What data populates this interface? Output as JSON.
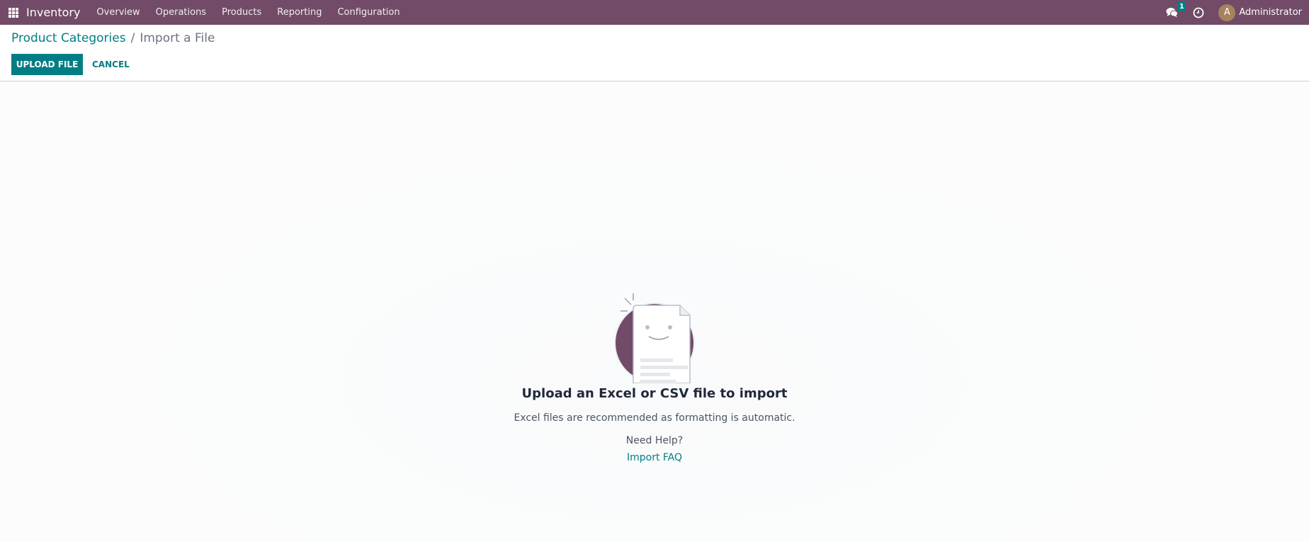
{
  "navbar": {
    "app_name": "Inventory",
    "menu": [
      "Overview",
      "Operations",
      "Products",
      "Reporting",
      "Configuration"
    ],
    "messages_badge": "1",
    "user_initial": "A",
    "user_name": "Administrator",
    "brand_color": "#714b67"
  },
  "control_panel": {
    "breadcrumb_parent": "Product Categories",
    "breadcrumb_separator": "/",
    "breadcrumb_current": "Import a File",
    "upload_button": "UPLOAD FILE",
    "cancel_button": "CANCEL",
    "accent_color": "#017e84"
  },
  "help": {
    "title": "Upload an Excel or CSV file to import",
    "subtitle": "Excel files are recommended as formatting is automatic.",
    "need_help": "Need Help?",
    "faq_link": "Import FAQ"
  }
}
